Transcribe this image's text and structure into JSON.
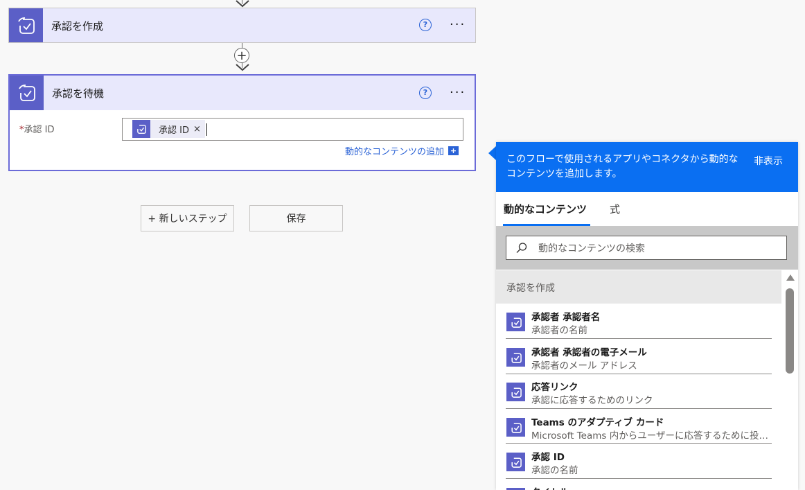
{
  "flow": {
    "create_card": {
      "title": "承認を作成"
    },
    "wait_card": {
      "title": "承認を待機",
      "field_required": "*",
      "field_label": "承認 ID",
      "token_label": "承認 ID",
      "token_remove": "×",
      "add_dynamic_link": "動的なコンテンツの追加",
      "add_dynamic_plus": "+"
    },
    "help_glyph": "?",
    "more_glyph": "···",
    "insert_step_glyph": "+"
  },
  "actions": {
    "new_step": "+ 新しいステップ",
    "save": "保存"
  },
  "panel": {
    "header_text": "このフローで使用されるアプリやコネクタから動的なコンテンツを追加します。",
    "hide": "非表示",
    "tabs": [
      {
        "label": "動的なコンテンツ",
        "active": true
      },
      {
        "label": "式",
        "active": false
      }
    ],
    "search_placeholder": "動的なコンテンツの検索",
    "section_title": "承認を作成",
    "items": [
      {
        "title": "承認者 承認者名",
        "desc": "承認者の名前"
      },
      {
        "title": "承認者 承認者の電子メール",
        "desc": "承認者のメール アドレス"
      },
      {
        "title": "応答リンク",
        "desc": "承認に応答するためのリンク"
      },
      {
        "title": "Teams のアダプティブ カード",
        "desc": "Microsoft Teams 内からユーザーに応答するために投稿..."
      },
      {
        "title": "承認 ID",
        "desc": "承認の名前"
      },
      {
        "title": "タイトル",
        "desc": ""
      }
    ]
  },
  "colors": {
    "accent": "#0a6ff2",
    "connector_purple": "#5b5fc7",
    "card_header": "#e8e8fc"
  }
}
